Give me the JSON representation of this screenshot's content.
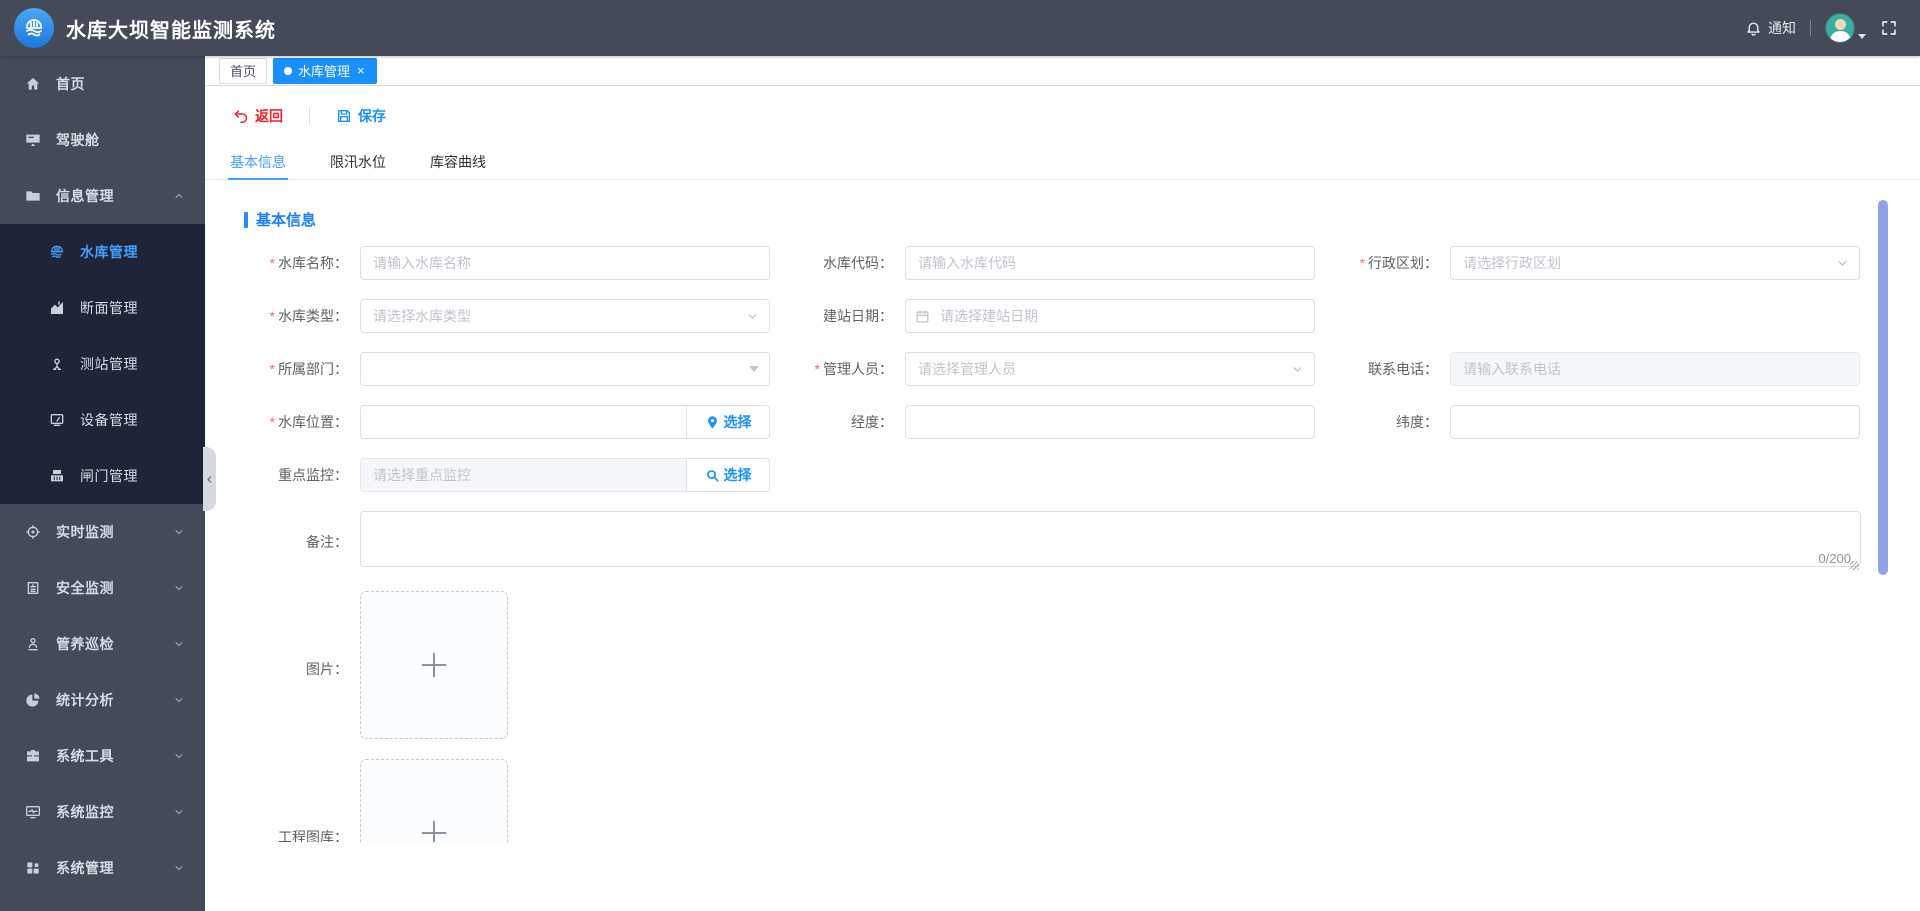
{
  "colors": {
    "header-bg": "#444a58",
    "sidebar-bg": "#444a58",
    "submenu-bg": "#1f2537",
    "accent": "#1890ff",
    "accent-light": "#409eff",
    "danger": "#f5222d",
    "scrollbar": "#8ea3e6"
  },
  "header": {
    "title": "水库大坝智能监测系统",
    "notification": "通知"
  },
  "sidebar": {
    "items": [
      {
        "label": "首页",
        "icon": "home-icon"
      },
      {
        "label": "驾驶舱",
        "icon": "cockpit-icon"
      },
      {
        "label": "信息管理",
        "icon": "folder-icon",
        "state": "expanded",
        "children": [
          {
            "label": "水库管理",
            "icon": "reservoir-icon",
            "active": true
          },
          {
            "label": "断面管理",
            "icon": "section-chart-icon"
          },
          {
            "label": "测站管理",
            "icon": "station-pin-icon"
          },
          {
            "label": "设备管理",
            "icon": "device-icon"
          },
          {
            "label": "闸门管理",
            "icon": "gate-icon"
          }
        ]
      },
      {
        "label": "实时监测",
        "icon": "realtime-icon",
        "state": "collapsed"
      },
      {
        "label": "安全监测",
        "icon": "safety-icon",
        "state": "collapsed"
      },
      {
        "label": "管养巡检",
        "icon": "inspection-icon",
        "state": "collapsed"
      },
      {
        "label": "统计分析",
        "icon": "stats-pie-icon",
        "state": "collapsed"
      },
      {
        "label": "系统工具",
        "icon": "tools-icon",
        "state": "collapsed"
      },
      {
        "label": "系统监控",
        "icon": "system-monitor-icon",
        "state": "collapsed"
      },
      {
        "label": "系统管理",
        "icon": "system-manage-icon",
        "state": "collapsed"
      }
    ]
  },
  "tags_bar": {
    "tabs": [
      {
        "label": "首页"
      },
      {
        "label": "水库管理",
        "active": true,
        "close": "×"
      }
    ]
  },
  "toolbar": {
    "back": "返回",
    "save": "保存"
  },
  "form_tabs": {
    "items": [
      {
        "label": "基本信息",
        "active": true
      },
      {
        "label": "限汛水位"
      },
      {
        "label": "库容曲线"
      }
    ]
  },
  "form": {
    "section_title": "基本信息",
    "required_mark": "*",
    "fields": {
      "reservoir_name": {
        "label": "水库名称：",
        "required": true,
        "placeholder": "请输入水库名称"
      },
      "reservoir_code": {
        "label": "水库代码：",
        "placeholder": "请输入水库代码"
      },
      "admin_region": {
        "label": "行政区划：",
        "required": true,
        "placeholder": "请选择行政区划"
      },
      "reservoir_type": {
        "label": "水库类型：",
        "required": true,
        "placeholder": "请选择水库类型"
      },
      "build_date": {
        "label": "建站日期：",
        "placeholder": "请选择建站日期"
      },
      "department": {
        "label": "所属部门：",
        "required": true,
        "placeholder": ""
      },
      "manager": {
        "label": "管理人员：",
        "required": true,
        "placeholder": "请选择管理人员"
      },
      "phone": {
        "label": "联系电话：",
        "placeholder": "请输入联系电话"
      },
      "location": {
        "label": "水库位置：",
        "required": true,
        "button": "选择"
      },
      "longitude": {
        "label": "经度："
      },
      "latitude": {
        "label": "纬度："
      },
      "key_monitor": {
        "label": "重点监控：",
        "placeholder": "请选择重点监控",
        "button": "选择"
      },
      "remark": {
        "label": "备注：",
        "counter": "0/200"
      },
      "image": {
        "label": "图片："
      },
      "gallery": {
        "label": "工程图库："
      }
    }
  }
}
